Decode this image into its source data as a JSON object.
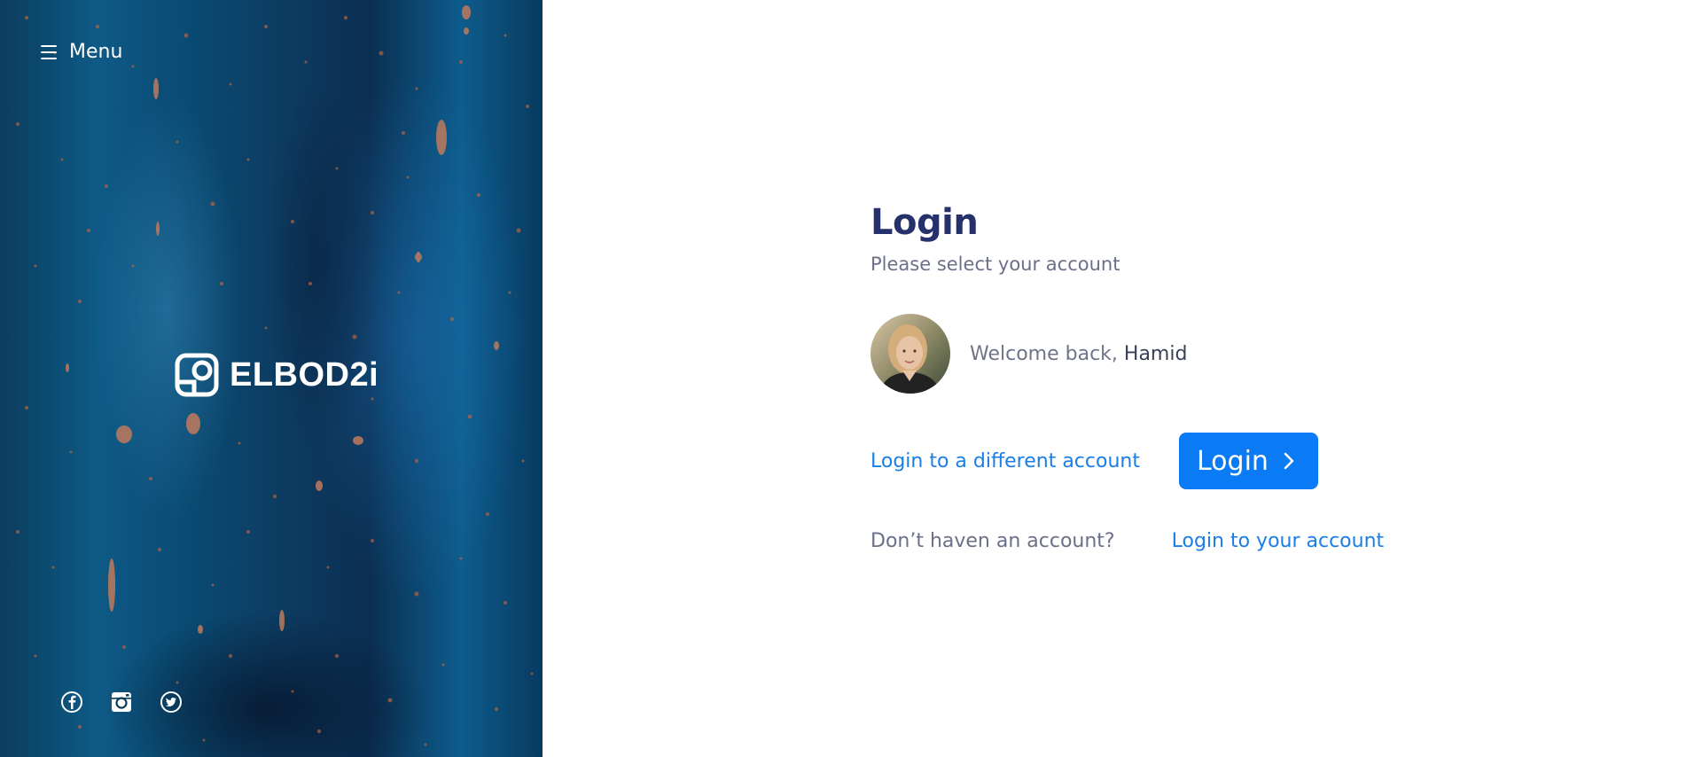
{
  "sidebar": {
    "menu_label": "Menu",
    "menu_icon": "hamburger-icon",
    "logo_text": "ELBOD2i",
    "logo_icon": "elbod2i-logo-icon",
    "socials": [
      {
        "icon": "facebook-icon"
      },
      {
        "icon": "instagram-icon"
      },
      {
        "icon": "twitter-icon"
      }
    ],
    "background": "#0b4a74"
  },
  "main": {
    "title": "Login",
    "subtitle": "Please select your account",
    "welcome_prefix": "Welcome back, ",
    "user_name": "Hamid",
    "different_account_link": "Login to a different account",
    "login_button": "Login",
    "no_account_text": "Don’t haven an account?",
    "login_your_account_link": "Login to your account"
  },
  "colors": {
    "title": "#26306a",
    "accent": "#0a7bf5",
    "link": "#1a7ee6",
    "muted": "#6b6f8a"
  }
}
